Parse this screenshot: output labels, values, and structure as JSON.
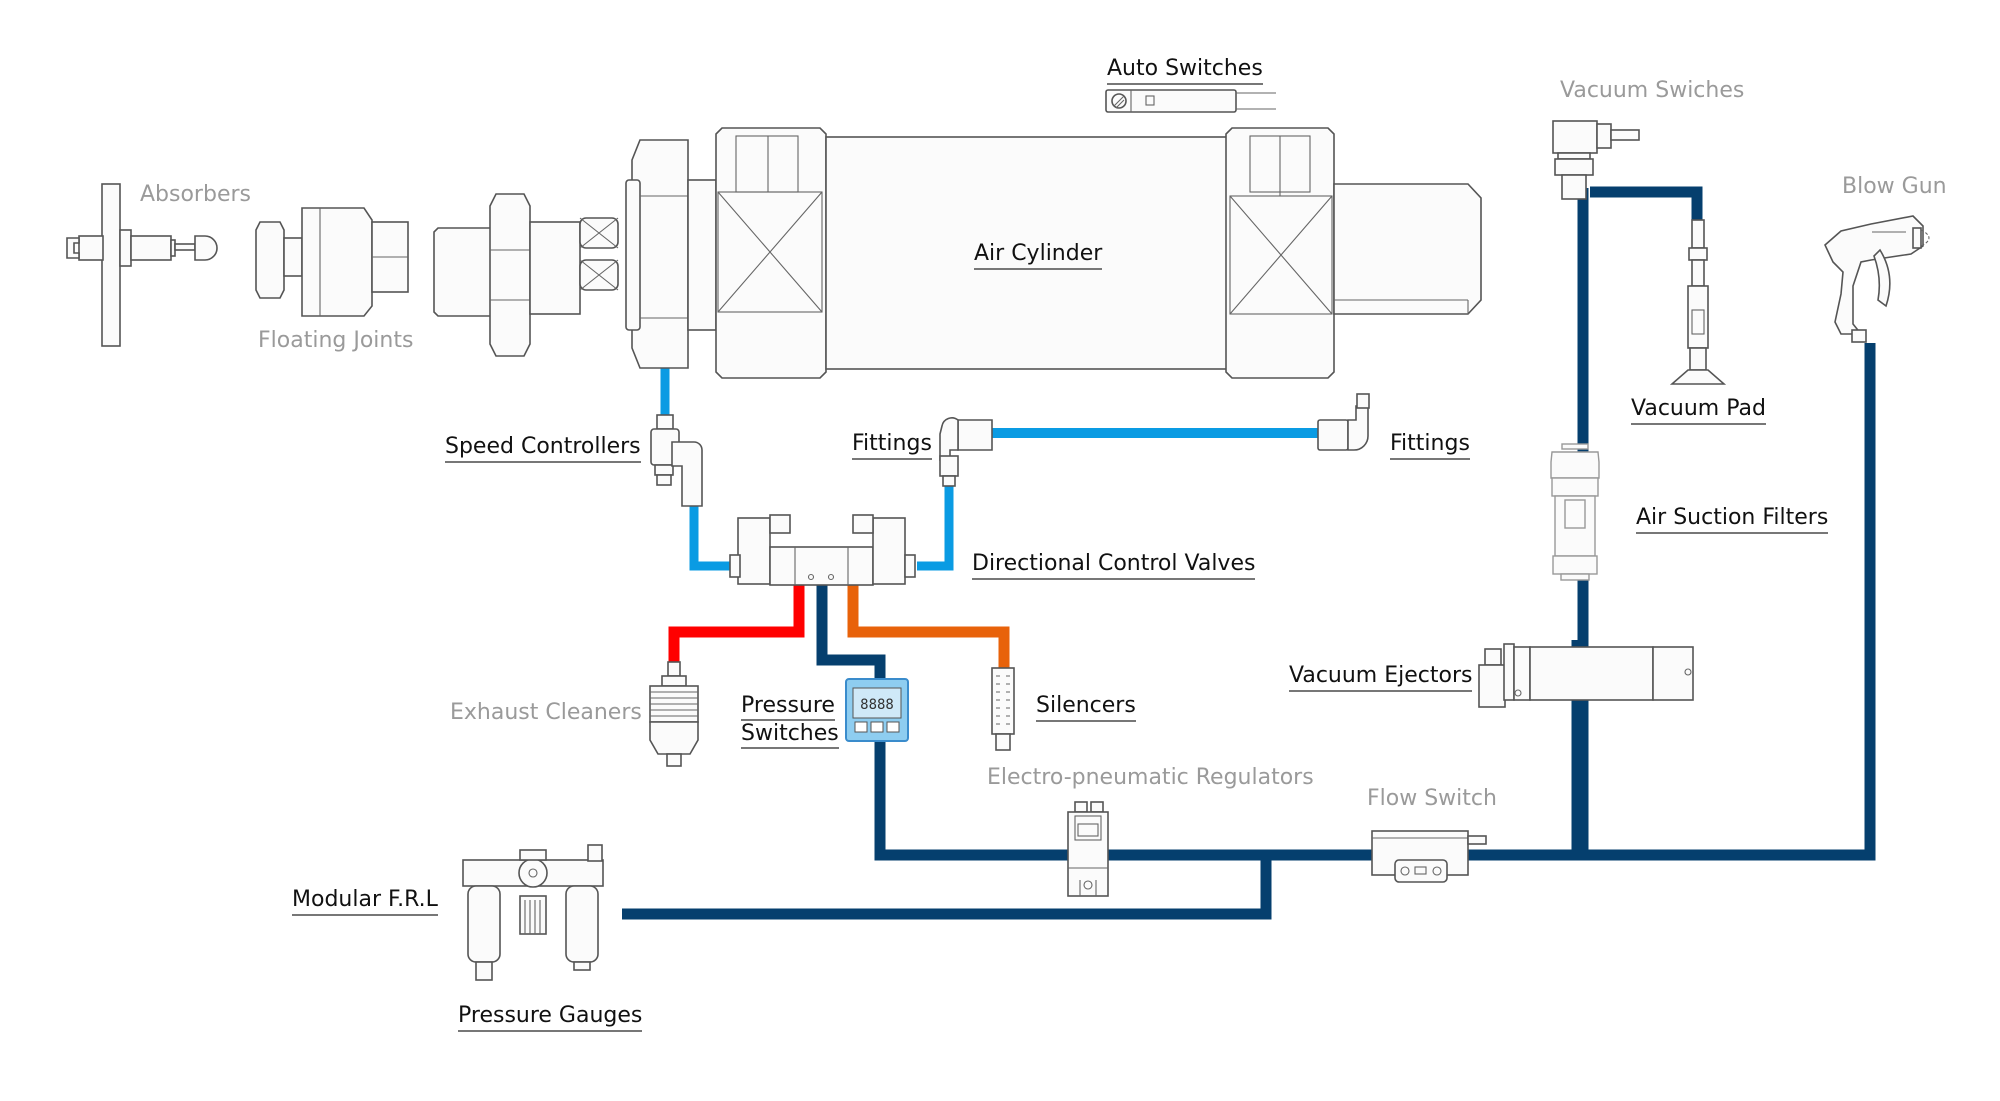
{
  "colors": {
    "pipe_light_blue": "#0a9be3",
    "pipe_navy": "#053f6e",
    "pipe_red": "#ff0000",
    "pipe_orange": "#e8620a",
    "label_dark": "#111111",
    "label_muted": "#9a9a9a",
    "pressure_switch_face": "#8ecdf0",
    "pressure_switch_border": "#3a8ccc"
  },
  "labels": {
    "absorbers": "Absorbers",
    "floating_joints": "Floating Joints",
    "auto_switches": "Auto Switches",
    "air_cylinder": "Air Cylinder",
    "vacuum_switches": "Vacuum Swiches",
    "blow_gun": "Blow Gun",
    "vacuum_pad": "Vacuum Pad",
    "speed_controllers": "Speed Controllers",
    "fittings_left": "Fittings",
    "fittings_right": "Fittings",
    "air_suction_filters": "Air Suction Filters",
    "directional_control_valves": "Directional Control Valves",
    "vacuum_ejectors": "Vacuum Ejectors",
    "exhaust_cleaners": "Exhaust Cleaners",
    "pressure_switches_line1": "Pressure",
    "pressure_switches_line2": "Switches",
    "silencers": "Silencers",
    "electro_pneumatic_regulators": "Electro-pneumatic Regulators",
    "flow_switch": "Flow Switch",
    "modular_frl": "Modular F.R.L",
    "pressure_gauges": "Pressure Gauges"
  },
  "label_styles": {
    "linked": [
      "auto_switches",
      "air_cylinder",
      "vacuum_pad",
      "speed_controllers",
      "fittings_left",
      "fittings_right",
      "air_suction_filters",
      "directional_control_valves",
      "vacuum_ejectors",
      "pressure_switches",
      "silencers",
      "modular_frl",
      "pressure_gauges"
    ],
    "unlinked": [
      "absorbers",
      "floating_joints",
      "vacuum_switches",
      "blow_gun",
      "exhaust_cleaners",
      "electro_pneumatic_regulators",
      "flow_switch"
    ]
  }
}
